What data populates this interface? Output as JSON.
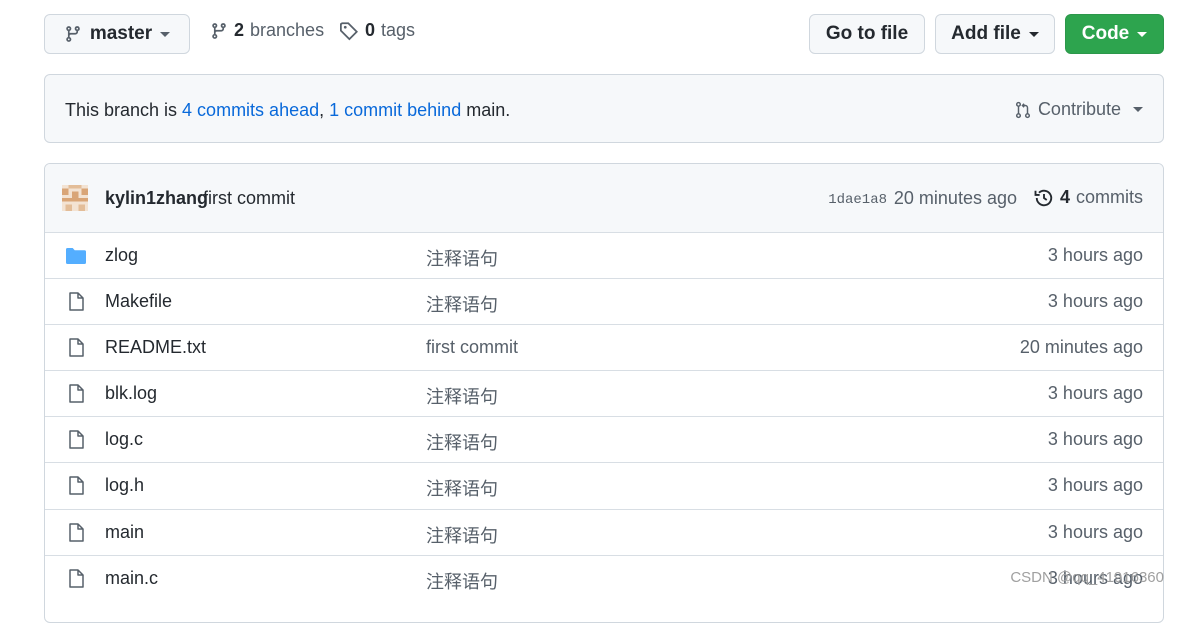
{
  "toolbar": {
    "branch_label": "master",
    "branches_count": "2",
    "branches_label": "branches",
    "tags_count": "0",
    "tags_label": "tags",
    "go_to_file": "Go to file",
    "add_file": "Add file",
    "code": "Code"
  },
  "branch_status": {
    "prefix": "This branch is ",
    "ahead": "4 commits ahead",
    "sep": ", ",
    "behind": "1 commit behind",
    "suffix": " main.",
    "contribute": "Contribute"
  },
  "latest_commit": {
    "author": "kylin1zhang",
    "message": "first commit",
    "sha": "1dae1a8",
    "time": "20 minutes ago",
    "commits_count": "4",
    "commits_label": "commits"
  },
  "files": [
    {
      "name": "zlog",
      "type": "folder",
      "message": "注释语句",
      "age": "3 hours ago"
    },
    {
      "name": "Makefile",
      "type": "file",
      "message": "注释语句",
      "age": "3 hours ago"
    },
    {
      "name": "README.txt",
      "type": "file",
      "message": "first commit",
      "age": "20 minutes ago"
    },
    {
      "name": "blk.log",
      "type": "file",
      "message": "注释语句",
      "age": "3 hours ago"
    },
    {
      "name": "log.c",
      "type": "file",
      "message": "注释语句",
      "age": "3 hours ago"
    },
    {
      "name": "log.h",
      "type": "file",
      "message": "注释语句",
      "age": "3 hours ago"
    },
    {
      "name": "main",
      "type": "file",
      "message": "注释语句",
      "age": "3 hours ago"
    },
    {
      "name": "main.c",
      "type": "file",
      "message": "注释语句",
      "age": "3 hours ago"
    }
  ],
  "watermark": "CSDN @qq_41916360",
  "colors": {
    "code_button": "#2da44e",
    "link": "#0969da",
    "folder": "#54aeff"
  }
}
